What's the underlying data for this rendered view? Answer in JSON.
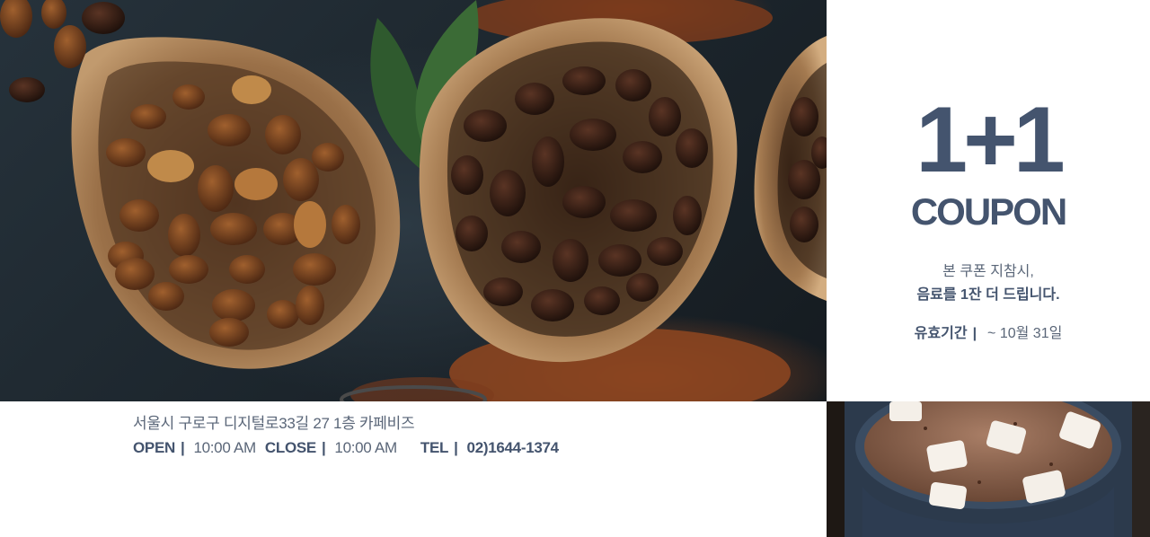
{
  "coupon": {
    "headline": "1+1",
    "word": "COUPON",
    "desc_line1": "본 쿠폰 지참시,",
    "desc_line2": "음료를 1잔  더 드립니다.",
    "validity_label": "유효기간",
    "validity_sep": "|",
    "validity_value": "~ 10월 31일"
  },
  "info": {
    "address": "서울시 구로구 디지털로33길 27 1층 카페비즈",
    "open_label": "OPEN",
    "open_time": "10:00 AM",
    "close_label": "CLOSE",
    "close_time": "10:00 AM",
    "tel_label": "TEL",
    "tel_value": "02)1644-1374",
    "separator": "|"
  },
  "images": {
    "main_photo": "coffee-beans-in-wooden-bowls",
    "side_photo": "hot-cocoa-with-marshmallows"
  },
  "colors": {
    "text_primary": "#44546e",
    "text_secondary": "#5a6678",
    "background": "#ffffff"
  }
}
